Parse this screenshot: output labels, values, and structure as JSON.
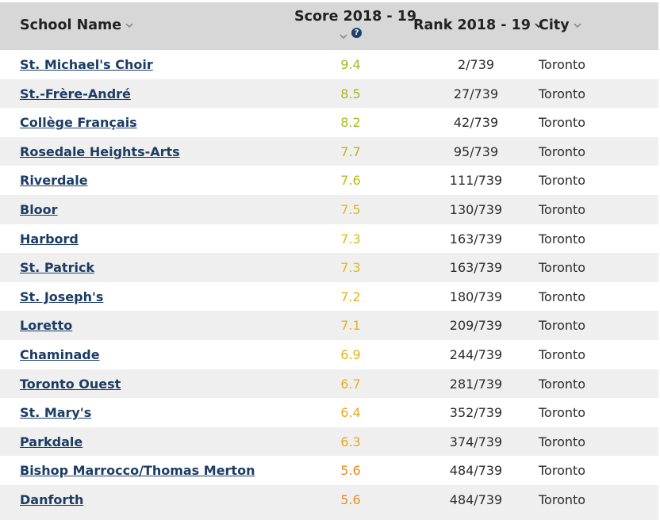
{
  "header": {
    "school_name": "School Name",
    "score": "Score 2018 - 19",
    "rank": "Rank 2018 - 19",
    "city": "City",
    "help_symbol": "?"
  },
  "colors": {
    "header_bg": "#d7d7d7",
    "alt_row_bg": "#efefef",
    "link": "#1b3c64",
    "score_high": "#9ab41f",
    "score_mid": "#e2b81a",
    "score_low": "#e89221"
  },
  "icons": [
    "chevron-down-icon",
    "help-icon"
  ],
  "rows": [
    {
      "name": "St. Michael's Choir",
      "score": "9.4",
      "rank": "2/739",
      "city": "Toronto",
      "score_color": "#a5b81c"
    },
    {
      "name": "St.-Frère-André",
      "score": "8.5",
      "rank": "27/739",
      "city": "Toronto",
      "score_color": "#a8b81c"
    },
    {
      "name": "Collège Français",
      "score": "8.2",
      "rank": "42/739",
      "city": "Toronto",
      "score_color": "#acb81c"
    },
    {
      "name": "Rosedale Heights-Arts",
      "score": "7.7",
      "rank": "95/739",
      "city": "Toronto",
      "score_color": "#b5b81c"
    },
    {
      "name": "Riverdale",
      "score": "7.6",
      "rank": "111/739",
      "city": "Toronto",
      "score_color": "#bab81c"
    },
    {
      "name": "Bloor",
      "score": "7.5",
      "rank": "130/739",
      "city": "Toronto",
      "score_color": "#dab81c"
    },
    {
      "name": "Harbord",
      "score": "7.3",
      "rank": "163/739",
      "city": "Toronto",
      "score_color": "#e2b81a"
    },
    {
      "name": "St. Patrick",
      "score": "7.3",
      "rank": "163/739",
      "city": "Toronto",
      "score_color": "#e2b81a"
    },
    {
      "name": "St. Joseph's",
      "score": "7.2",
      "rank": "180/739",
      "city": "Toronto",
      "score_color": "#e4b41a"
    },
    {
      "name": "Loretto",
      "score": "7.1",
      "rank": "209/739",
      "city": "Toronto",
      "score_color": "#e6b21a"
    },
    {
      "name": "Chaminade",
      "score": "6.9",
      "rank": "244/739",
      "city": "Toronto",
      "score_color": "#e8b01a"
    },
    {
      "name": "Toronto Ouest",
      "score": "6.7",
      "rank": "281/739",
      "city": "Toronto",
      "score_color": "#e9ac1c"
    },
    {
      "name": "St. Mary's",
      "score": "6.4",
      "rank": "352/739",
      "city": "Toronto",
      "score_color": "#eaa81e"
    },
    {
      "name": "Parkdale",
      "score": "6.3",
      "rank": "374/739",
      "city": "Toronto",
      "score_color": "#eaa41e"
    },
    {
      "name": "Bishop Marrocco/Thomas Merton",
      "score": "5.6",
      "rank": "484/739",
      "city": "Toronto",
      "score_color": "#e98d20"
    },
    {
      "name": "Danforth",
      "score": "5.6",
      "rank": "484/739",
      "city": "Toronto",
      "score_color": "#e98d20"
    }
  ]
}
